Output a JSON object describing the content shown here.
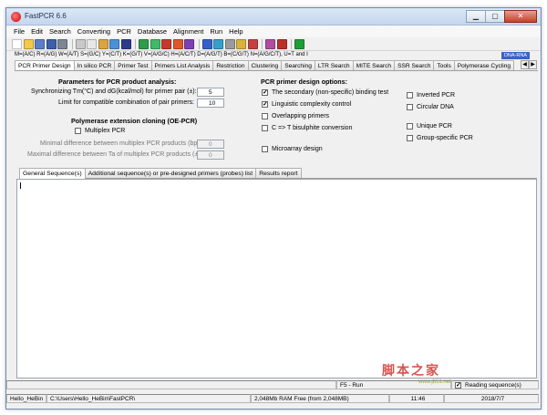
{
  "window": {
    "title": "FastPCR 6.6"
  },
  "menu": [
    "File",
    "Edit",
    "Search",
    "Converting",
    "PCR",
    "Database",
    "Alignment",
    "Run",
    "Help"
  ],
  "toolbar": {
    "icons": [
      {
        "name": "new-icon",
        "color": "#ffffff"
      },
      {
        "name": "open-icon",
        "color": "#f2c94c"
      },
      {
        "name": "save-icon",
        "color": "#5a7fc8"
      },
      {
        "name": "save-all-icon",
        "color": "#3b5fa8"
      },
      {
        "name": "print-icon",
        "color": "#7b8794"
      },
      {
        "name": "cut-icon",
        "color": "#c9c9c9"
      },
      {
        "name": "copy-icon",
        "color": "#e8e8e8"
      },
      {
        "name": "paste-icon",
        "color": "#d9a441"
      },
      {
        "name": "find-icon",
        "color": "#4a90d9"
      },
      {
        "name": "binoculars-icon",
        "color": "#2d3a8c"
      },
      {
        "name": "convert-icon",
        "color": "#2e9c4a"
      },
      {
        "name": "translate-icon",
        "color": "#41b86a"
      },
      {
        "name": "reverse-icon",
        "color": "#c8372d"
      },
      {
        "name": "complement-icon",
        "color": "#e0572b"
      },
      {
        "name": "reverse-complement-icon",
        "color": "#7e3fb3"
      },
      {
        "name": "primer-icon",
        "color": "#3560c9"
      },
      {
        "name": "pcr-icon",
        "color": "#35a0c9"
      },
      {
        "name": "database-icon",
        "color": "#9a9a9a"
      },
      {
        "name": "alignment-icon",
        "color": "#d9b13b"
      },
      {
        "name": "report-icon",
        "color": "#c44040"
      },
      {
        "name": "settings-icon",
        "color": "#b04da0"
      },
      {
        "name": "tree-icon",
        "color": "#b9322a"
      },
      {
        "name": "run-icon",
        "color": "#1e9e34"
      }
    ]
  },
  "iupac_text": "M=(A/C) R=(A/G) W=(A/T) S=(G/C) Y=(C/T) K=(G/T) V=(A/G/C) H=(A/C/T) D=(A/G/T) B=(C/G/T) N=(A/G/C/T), U=T and I",
  "dna_rna": "DNA-RNA",
  "tabs": [
    "PCR Primer Design",
    "In silico PCR",
    "Primer Test",
    "Primers List Analysis",
    "Restriction",
    "Clustering",
    "Searching",
    "LTR Search",
    "MITE Search",
    "SSR Search",
    "Tools",
    "Polymerase Cycling"
  ],
  "scroll": {
    "left": "◀",
    "right": "▶"
  },
  "params": {
    "title": "Parameters for PCR product analysis:",
    "sync_label": "Synchronizing Tm(°C) and dG(kcal/mol) for primer pair (±):",
    "sync_value": "5",
    "limit_label": "Limit for compatible combination of pair primers:",
    "limit_value": "10",
    "oe_title": "Polymerase extension cloning (OE-PCR)",
    "multiplex_label": "Multiplex PCR",
    "min_diff_label": "Minimal difference between multiplex PCR products (bp):",
    "min_diff_value": "0",
    "max_diff_label": "Maximal difference between Ta of multiplex PCR products (±°C):",
    "max_diff_value": "0"
  },
  "design": {
    "title": "PCR primer design options:",
    "check_mark": "✓",
    "options": [
      {
        "label": "The secondary (non-specific) binding test",
        "checked": true
      },
      {
        "label": "Linguistic complexity control",
        "checked": true
      },
      {
        "label": "Overlapping primers",
        "checked": false
      },
      {
        "label": "C => T bisulphite conversion",
        "checked": false
      },
      {
        "label": "Microarray design",
        "checked": false
      }
    ],
    "right_options": [
      {
        "label": "Inverted PCR",
        "checked": false
      },
      {
        "label": "Circular DNA",
        "checked": false
      },
      {
        "label": "Unique PCR",
        "checked": false
      },
      {
        "label": "Group-specific PCR",
        "checked": false
      }
    ]
  },
  "subtabs": [
    "General Sequence(s)",
    "Additional sequence(s) or pre-designed primers (probes) list",
    "Results report"
  ],
  "watermark": {
    "main": "脚本之家",
    "sub": "www.jb51.net"
  },
  "status1": {
    "run": "F5 - Run",
    "reading_label": "Reading sequence(s)",
    "check_mark": "✓"
  },
  "status2": {
    "user": "Hello_HeBin",
    "path": "C:\\Users\\Hello_HeBin\\FastPCR\\",
    "ram": "2,048Mb RAM Free (from 2,048MB)",
    "time": "11:46",
    "date": "2018/7/7"
  }
}
